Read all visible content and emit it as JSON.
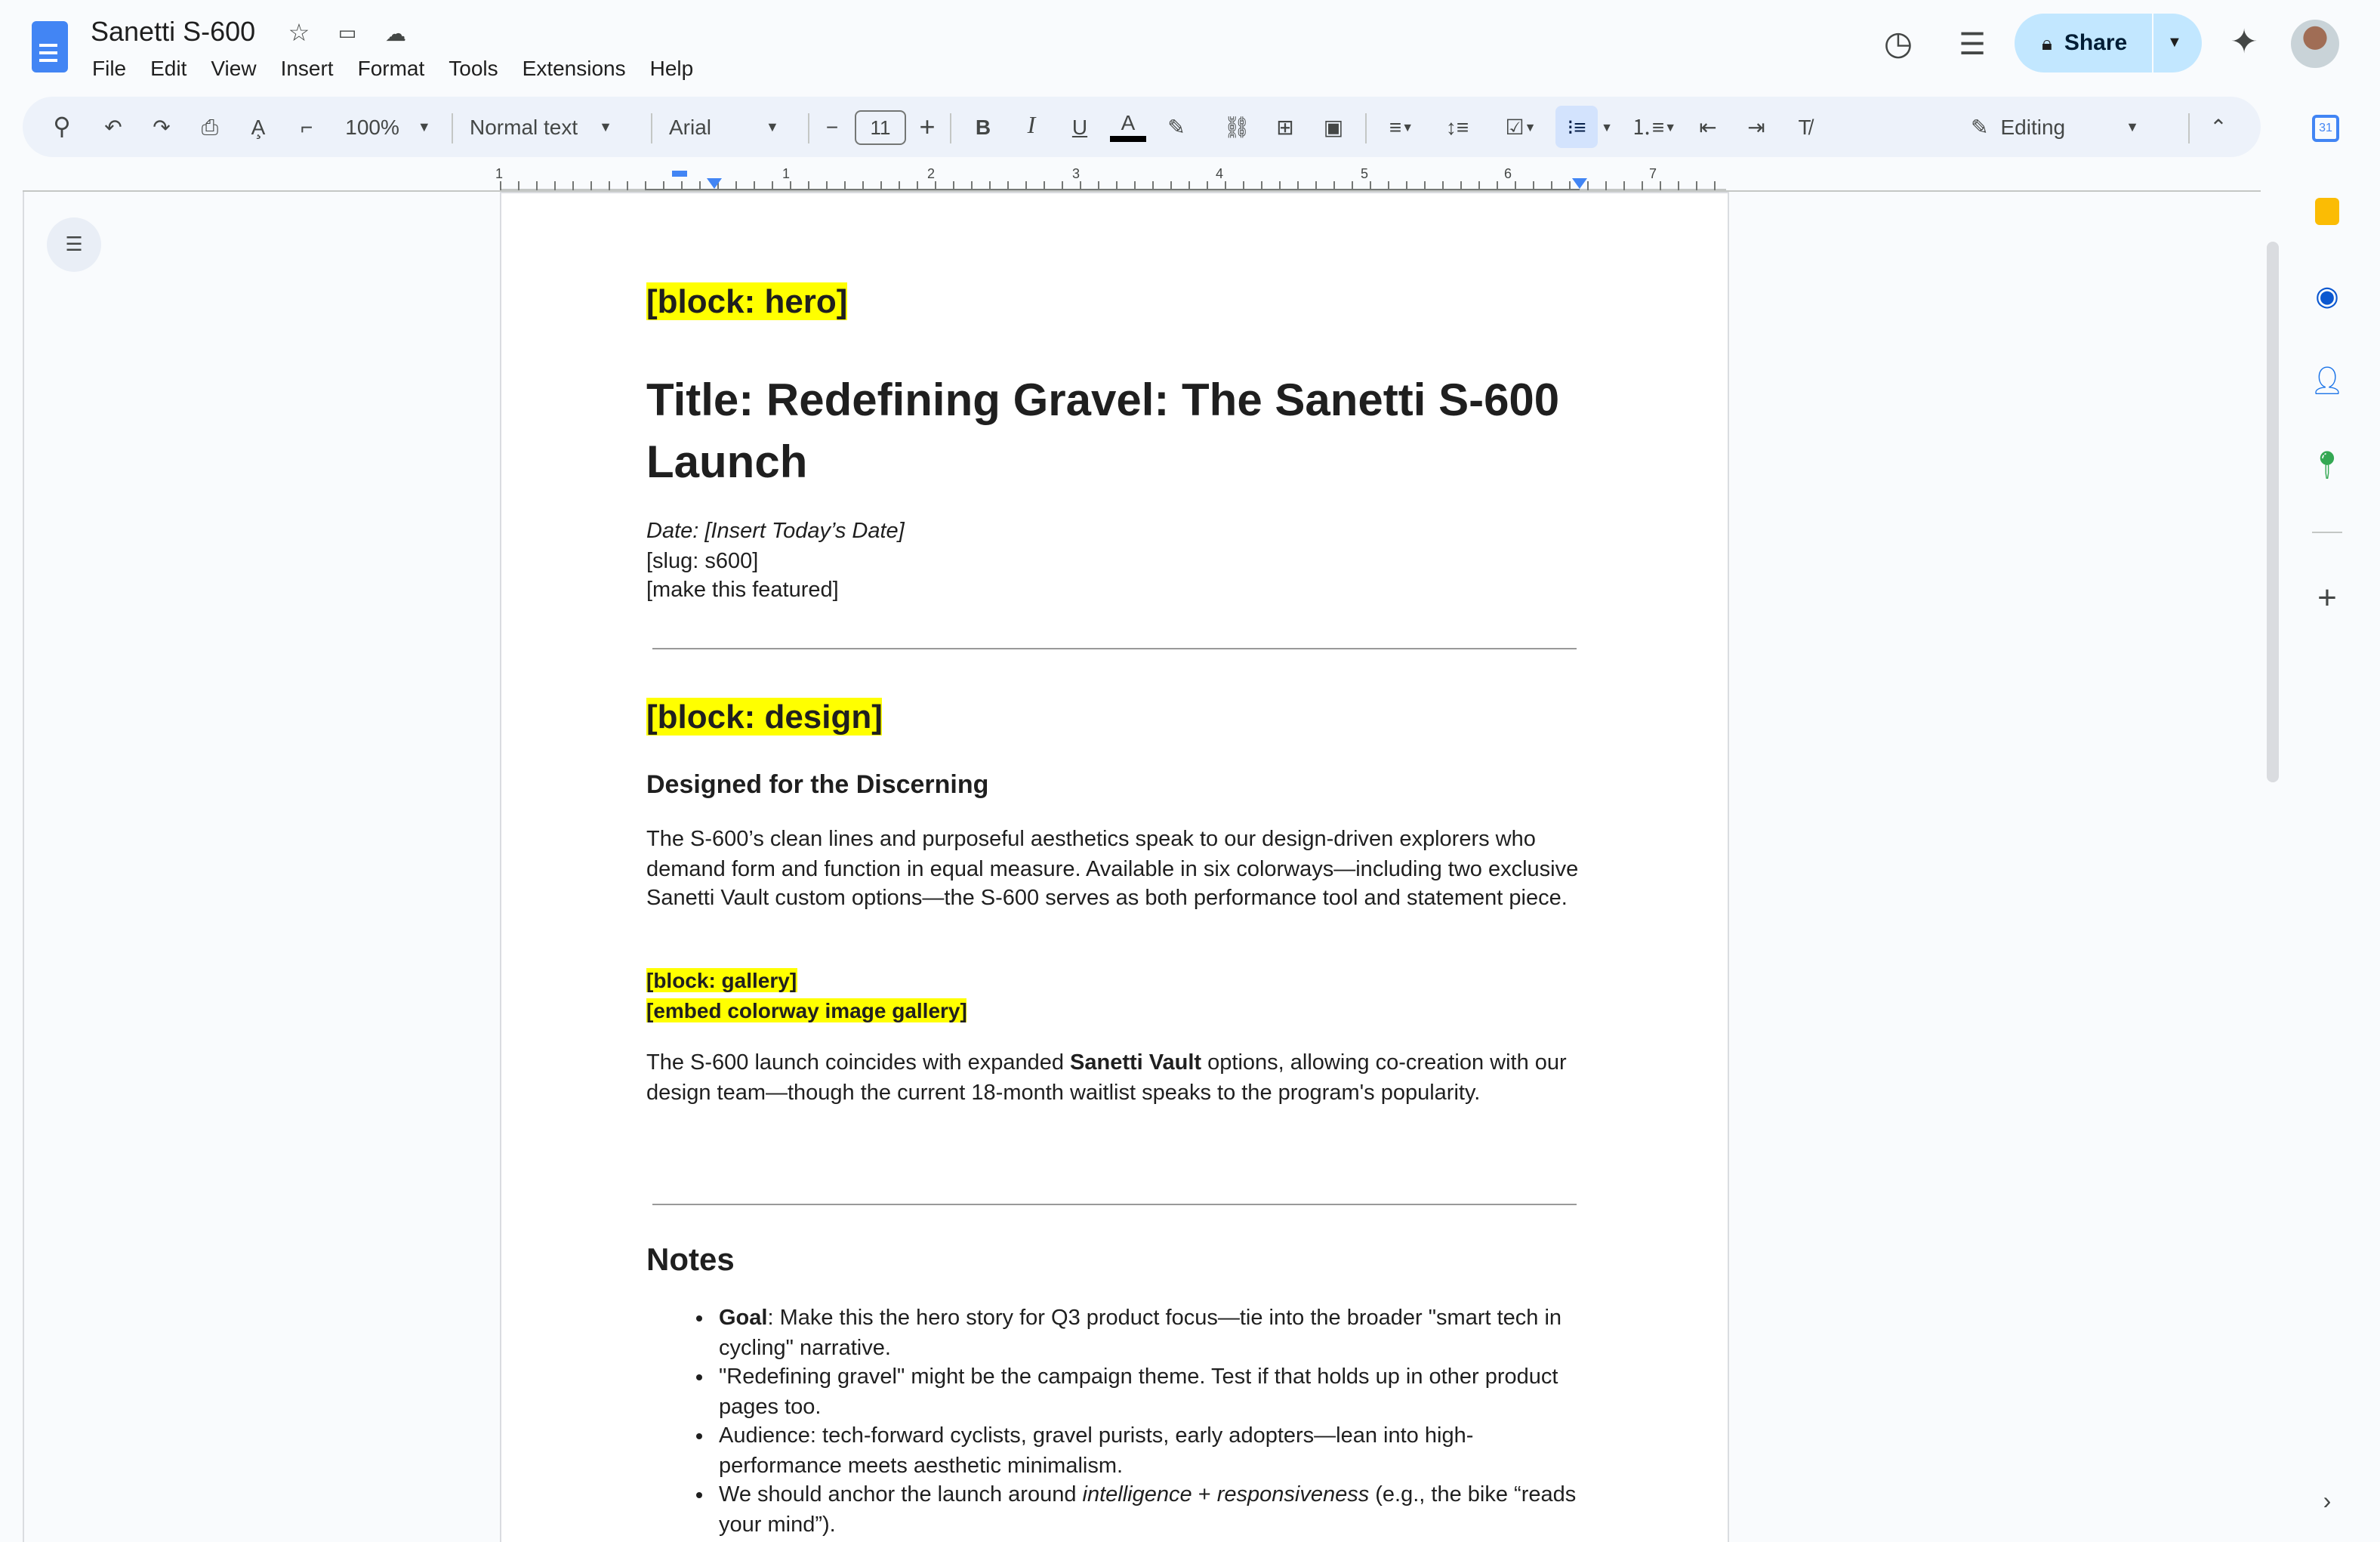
{
  "doc_title": "Sanetti S-600",
  "menu": [
    "File",
    "Edit",
    "View",
    "Insert",
    "Format",
    "Tools",
    "Extensions",
    "Help"
  ],
  "share_label": "Share",
  "toolbar": {
    "zoom": "100%",
    "style": "Normal text",
    "font": "Arial",
    "font_size": "11",
    "mode": "Editing"
  },
  "ruler": [
    "1",
    "1",
    "2",
    "3",
    "4",
    "5",
    "6",
    "7"
  ],
  "content": {
    "hero_tag": "[block: hero]",
    "title": "Title: Redefining Gravel: The Sanetti S-600 Launch",
    "date": "Date: [Insert Today’s Date]",
    "slug": "[slug: s600]",
    "featured": "[make this featured]",
    "design_tag": "[block: design]",
    "design_heading": "Designed for the Discerning",
    "design_para": "The S-600’s clean lines and purposeful aesthetics speak to our design-driven explorers who demand form and function in equal measure. Available in six colorways—including two exclusive Sanetti Vault custom options—the S-600 serves as both performance tool and statement piece.",
    "gallery_tag": "[block: gallery]",
    "gallery_embed": "[embed colorway image gallery]",
    "vault_para_1": "The S-600 launch coincides with expanded ",
    "vault_bold": "Sanetti Vault",
    "vault_para_2": " options, allowing co-creation with our design team—though the current 18-month waitlist speaks to the program's popularity.",
    "notes_heading": "Notes",
    "notes": {
      "n1_bold": "Goal",
      "n1": ": Make this the hero story for Q3 product focus—tie into the broader \"smart tech in cycling\" narrative.",
      "n2": "\"Redefining gravel\" might be the campaign theme. Test if that holds up in other product pages too.",
      "n3": "Audience: tech-forward cyclists, gravel purists, early adopters—lean into high-performance meets aesthetic minimalism.",
      "n4a": "We should anchor the launch around ",
      "n4i1": "intelligence",
      "n4b": " + ",
      "n4i2": "responsiveness",
      "n4c": " (e.g., the bike “reads your mind”)."
    }
  },
  "colors": {
    "accent": "#0b57d0",
    "share_bg": "#c2e7ff",
    "highlight": "#ffff00"
  }
}
